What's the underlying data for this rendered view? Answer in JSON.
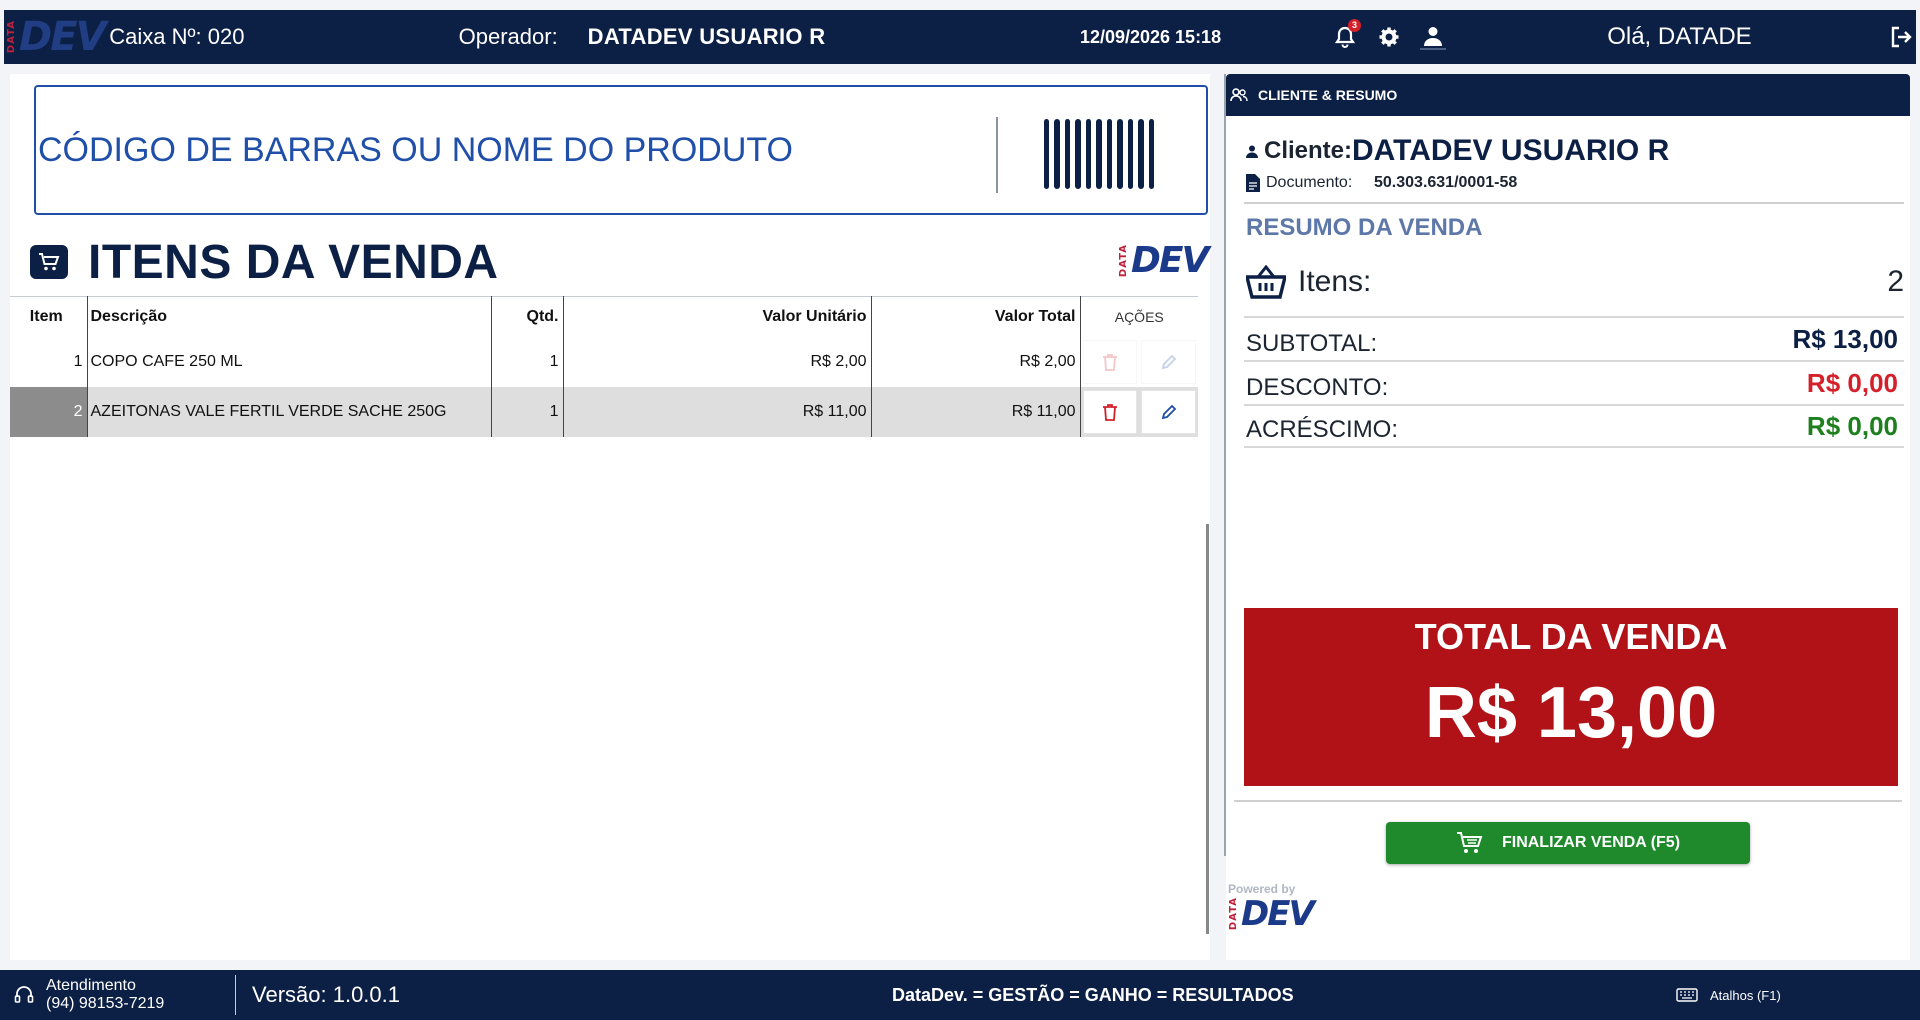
{
  "brand": {
    "logo_small": "DATA",
    "logo_main": "DEV"
  },
  "header": {
    "caixa": "Caixa Nº: 020",
    "operador_label": "Operador:",
    "operador_name": "DATADEV USUARIO R",
    "datetime": "12/09/2026 15:18",
    "notif_count": "3",
    "greeting": "Olá, DATADE"
  },
  "search": {
    "placeholder": "CÓDIGO DE BARRAS OU NOME DO PRODUTO"
  },
  "items": {
    "title": "ITENS DA VENDA",
    "columns": {
      "item": "Item",
      "desc": "Descrição",
      "qtd": "Qtd.",
      "unit": "Valor Unitário",
      "total": "Valor Total",
      "actions": "AÇÕES"
    },
    "rows": [
      {
        "item": "1",
        "desc": "COPO CAFE 250 ML",
        "qtd": "1",
        "unit": "R$ 2,00",
        "total": "R$ 2,00"
      },
      {
        "item": "2",
        "desc": "AZEITONAS VALE FERTIL VERDE SACHE 250G",
        "qtd": "1",
        "unit": "R$ 11,00",
        "total": "R$ 11,00"
      }
    ]
  },
  "summary": {
    "header": "CLIENTE & RESUMO",
    "cliente_label": "Cliente:",
    "cliente_name": "DATADEV USUARIO R",
    "doc_label": "Documento:",
    "doc_value": "50.303.631/0001-58",
    "resumo_title": "RESUMO DA VENDA",
    "itens_label": "Itens:",
    "itens_value": "2",
    "subtotal_label": "SUBTOTAL:",
    "subtotal_value": "R$ 13,00",
    "desconto_label": "DESCONTO:",
    "desconto_value": "R$ 0,00",
    "acrescimo_label": "ACRÉSCIMO:",
    "acrescimo_value": "R$ 0,00",
    "total_label": "TOTAL DA VENDA",
    "total_value": "R$ 13,00",
    "finalize_label": "FINALIZAR VENDA (F5)",
    "powered_by": "Powered by"
  },
  "footer": {
    "atendimento_label": "Atendimento",
    "atendimento_phone": "(94) 98153-7219",
    "version": "Versão: 1.0.0.1",
    "slogan": "DataDev. = GESTÃO = GANHO = RESULTADOS",
    "shortcuts": "Atalhos (F1)"
  },
  "colors": {
    "navy": "#0c1f45",
    "total_red": "#b01217",
    "finalize_green": "#1f8a2b",
    "discount_red": "#d4202a",
    "surcharge_green": "#1d7f1d"
  }
}
